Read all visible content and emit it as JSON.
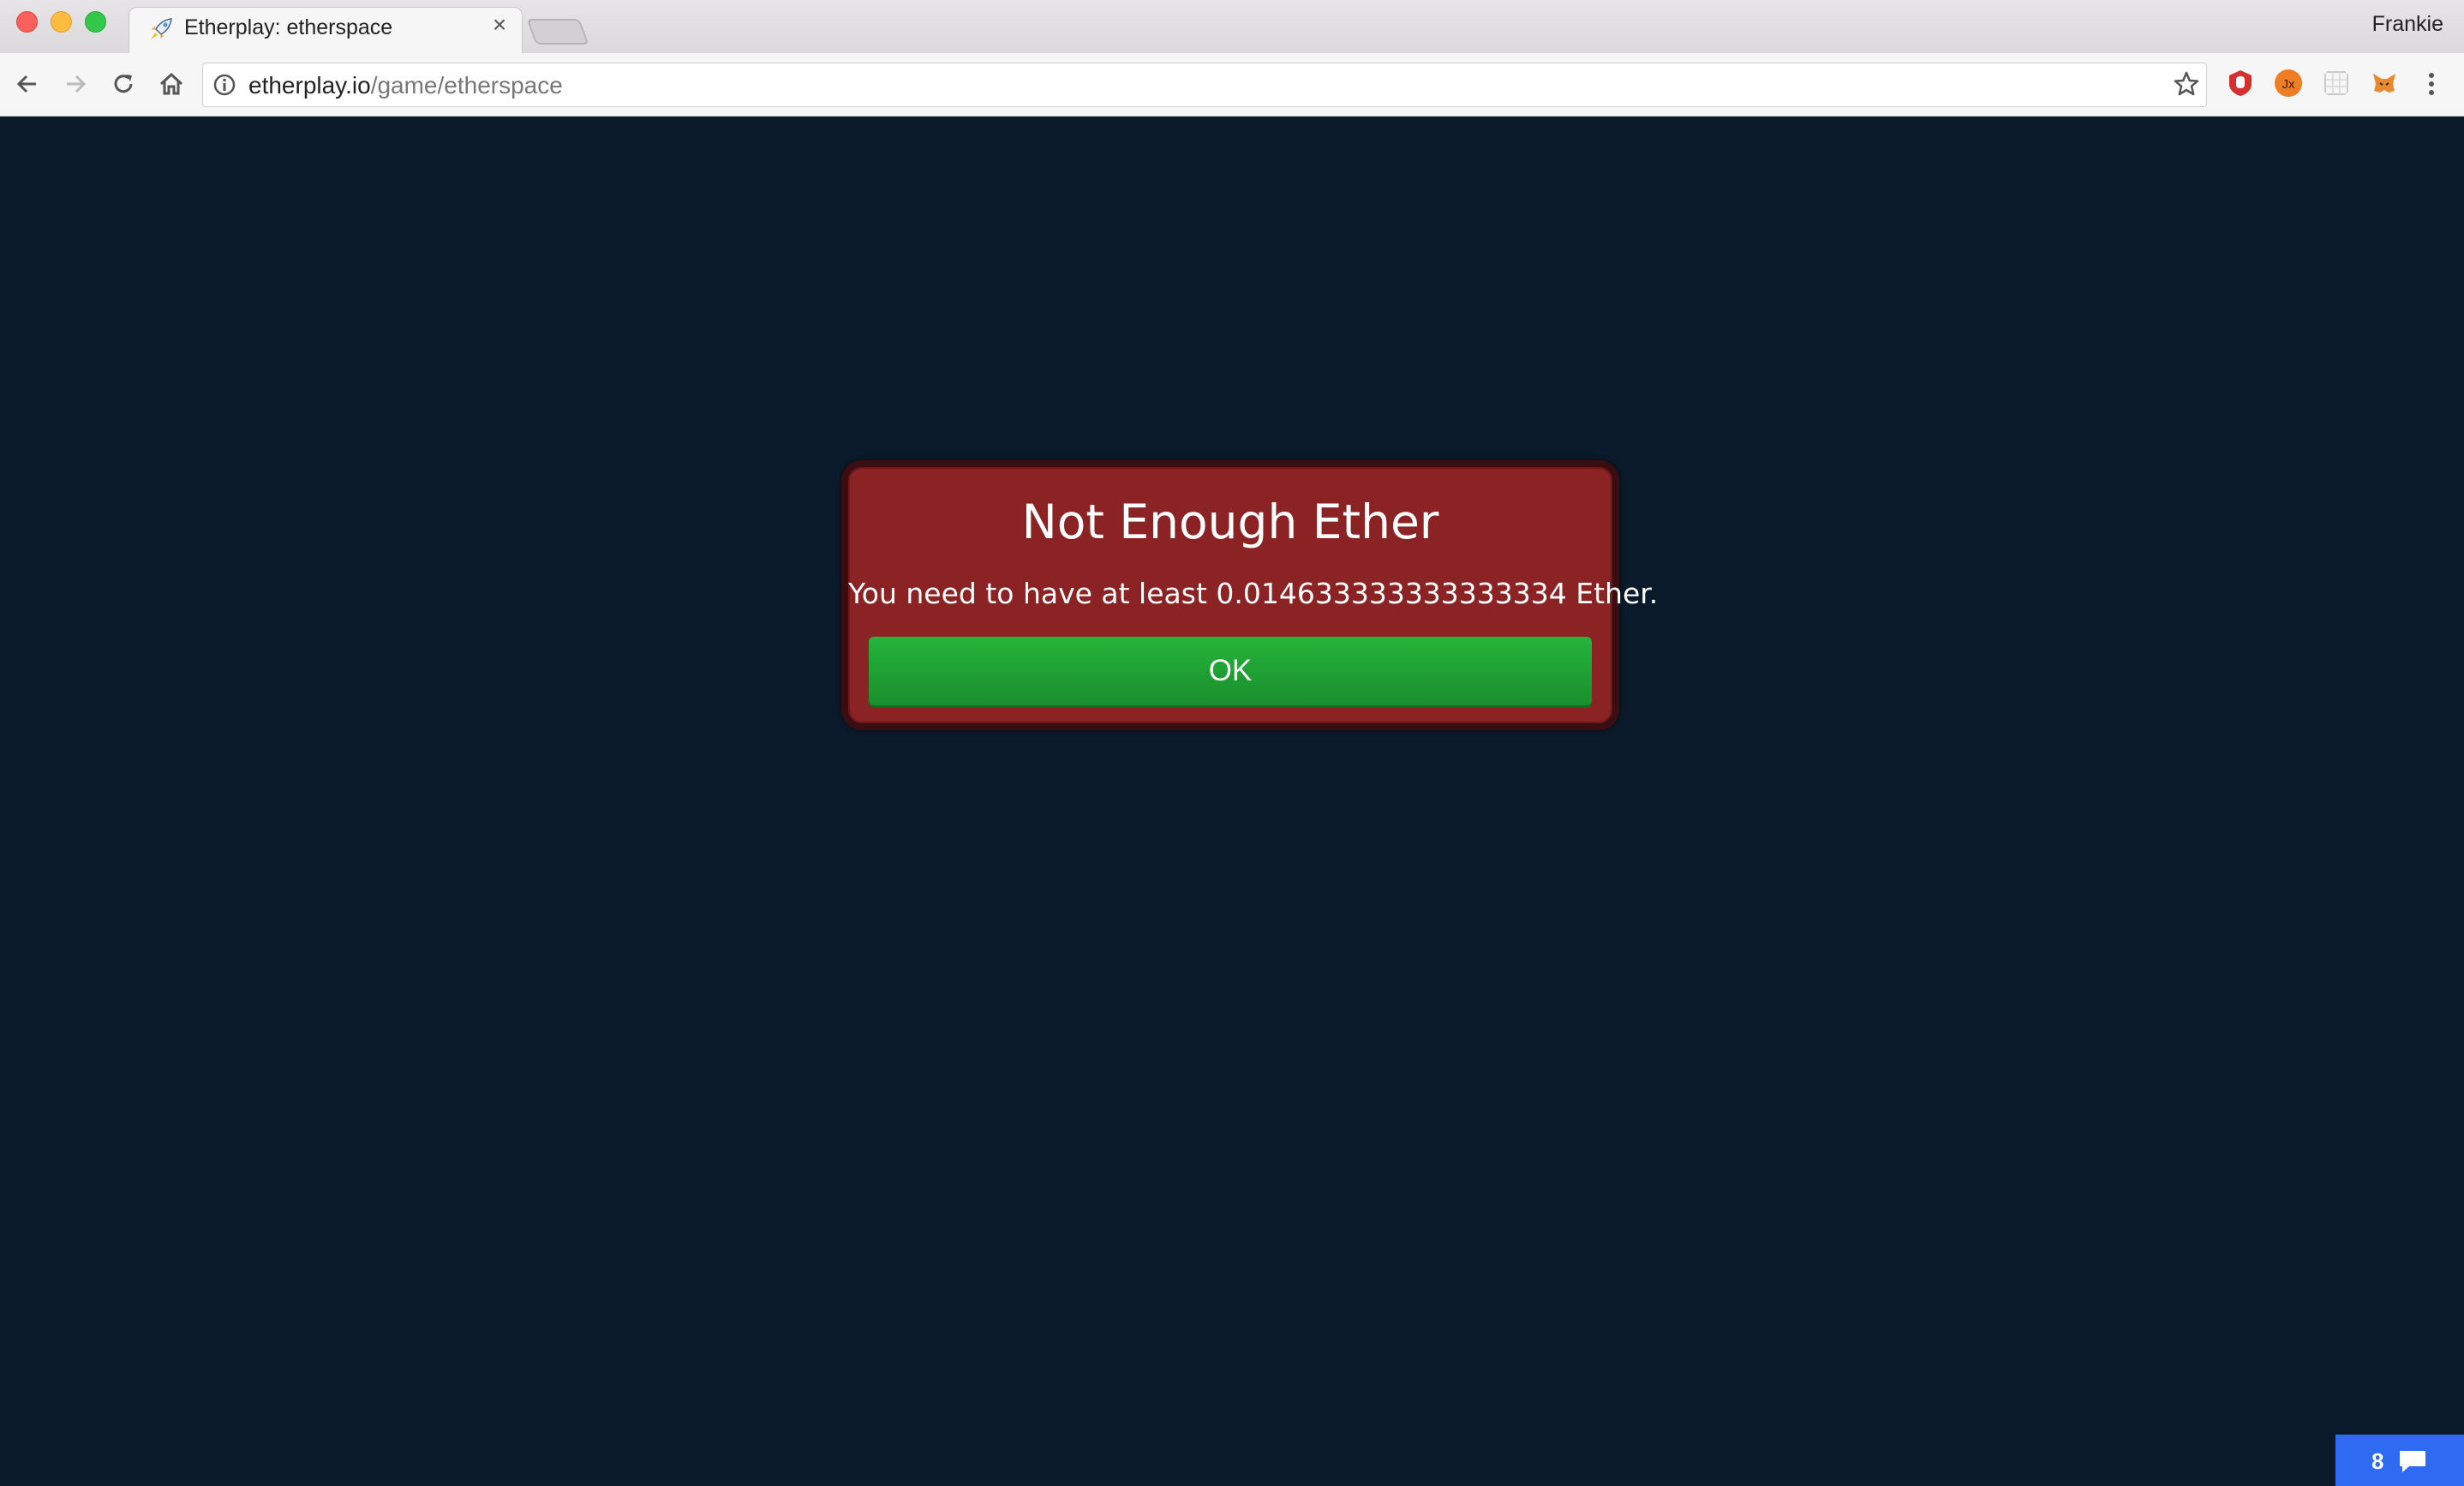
{
  "browser": {
    "tab": {
      "title": "Etherplay: etherspace",
      "close_glyph": "×",
      "icon": "rocket-icon"
    },
    "profile_name": "Frankie",
    "url": {
      "host": "etherplay.io",
      "path": "/game/etherspace"
    },
    "toolbar_icons": [
      "back-icon",
      "forward-icon",
      "reload-icon",
      "home-icon",
      "info-icon",
      "star-icon"
    ],
    "extensions": [
      "ublock-icon",
      "jx-extension-icon",
      "grid-extension-icon",
      "metamask-fox-icon",
      "menu-kebab-icon"
    ]
  },
  "dialog": {
    "title": "Not Enough Ether",
    "message": "You need to have at least 0.014633333333333334 Ether.",
    "ok_label": "OK"
  },
  "chat_widget": {
    "count": "8",
    "icon": "chat-bubble-icon"
  },
  "colors": {
    "page_background": "#0b1a2a",
    "dialog_background": "#8b2224",
    "ok_button": "#21a334",
    "chat_widget": "#2f6bf2"
  }
}
